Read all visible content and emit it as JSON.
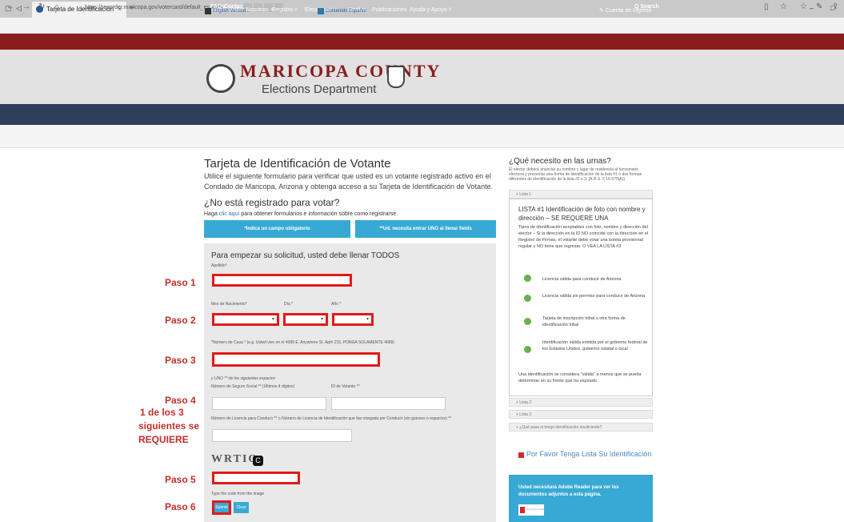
{
  "browser": {
    "tab_title": "Tarjeta de Identificación",
    "url": "https://recorder.maricopa.gov/votercard/default_es.aspx",
    "new_tab": "+",
    "min": "–",
    "max": "□"
  },
  "topbar": {
    "faqs": "FAQs",
    "contact": "Contact",
    "search": "Q Search"
  },
  "header": {
    "brand": "MARICOPA COUNTY",
    "dept": "Elections Department"
  },
  "nav": {
    "items": [
      "Inicio",
      "Sobre Nosotros ˅",
      "Registro ˅",
      "Elecciones ˅",
      "Medios",
      "Publicaciones",
      "Ayuda y Apoyo ˅"
    ],
    "login": "✎ Cuenta de Ingreso"
  },
  "lang": {
    "english": "English Version",
    "spanish": "Contenido Español"
  },
  "main": {
    "title": "Tarjeta de Identificación de Votante",
    "intro": "Utilice el siguiente formulario para verificar que usted es un votante registrado activo en el Condado de Maricopa, Arizona y obtenga acceso a su Tarjeta de Identificación de Votante.",
    "subtitle": "¿No está registrado para votar?",
    "haga": "Haga",
    "haga_link": "clic aquí",
    "haga_rest": "para obtener formularios e información sobre como registrarse.",
    "btn1": "*Indica un campo obligatorio",
    "btn2": "**Ud. necesita entrar UNO al llenar fields",
    "form_title": "Para empezar su solicitud, usted debe llenar TODOS",
    "apellido": "Apellido*",
    "mes": "Mes de Nacimiento*",
    "dia": "Día *",
    "anio": "Año *",
    "casa": "*Número de Casa * (e.g. Usted vive en el 4089 E. Anywhere St. Apt# 215, PONGA SOLAMENTE 4089)",
    "uno": "y UNO ** de los siguientes espacios",
    "ss": "Número de Seguro Social ** (Últimos 4 dígitos)",
    "id": "ID de Votante **",
    "lic": "Número de Licencia para Conducir ** o Número de Licencia de Identificación que fue otorgada por Conducir (sin guiones o espacios) **",
    "captcha": "WRTIQ",
    "refresh": "C",
    "type_code": "Type the code from the image",
    "submit": "Submit",
    "clear": "Clear"
  },
  "annotations": {
    "paso1": "Paso 1",
    "paso2": "Paso 2",
    "paso3": "Paso 3",
    "paso4": "Paso 4",
    "uno_line1": "1 de los 3",
    "uno_line2": "siguientes se",
    "uno_line3": "REQUIERE",
    "paso5": "Paso 5",
    "paso6": "Paso 6"
  },
  "sidebar": {
    "title": "¿Qué necesito en las urnas?",
    "text": "El elector deberá anunciar su nombre y lugar de residencia al funcionario electoral y presentar una forma de identificación de la lista #1 ó dos formas diferentes de identificación de la lista #2 o 3. [A.R.S. § 16-579(A)]",
    "lista1": "+ Lista 1",
    "l1_title": "LISTA #1 Identificación de foto con nombre y dirección – SE REQUERE UNA",
    "l1_text": "Tipos de identificación aceptables con foto, nombre y dirección del elector – Si la dirección en la ID NO coincide con la dirección en el Registro de Firmas, el votante debe votar una boleta provisional regular y NO tiene que regresar. O VEA LA LISTA #3",
    "items": [
      "Licencia válida para conducir de Arizona",
      "Licencia válida sin permiso para conducir de Arizona",
      "Tarjeta de inscripción tribal u otra forma de identificación tribal",
      "Identificación válida emitida por el gobierno federal de los Estados Unidos, gobierno estatal o local"
    ],
    "footnote": "Una identificación se considera \"válida\" a menos que se pueda determinar en su frente que ha expirado.",
    "lista2": "+ Lista 2",
    "lista3": "+ Lista 3",
    "qa": "+ ¿Qué pasa si tengo identificación insuficiente?",
    "fav_title": "Por Favor Tenga Lista Su Identificación",
    "blue_text": "Usted necesitará Adobe Reader para ver los documentos adjuntos a esta página.",
    "reader": "Get Adobe Reader"
  },
  "colors": {
    "red": "#8b1c1c",
    "nav": "#2e3f5c",
    "blue": "#38a9d4",
    "annotation": "#e11a1a"
  }
}
